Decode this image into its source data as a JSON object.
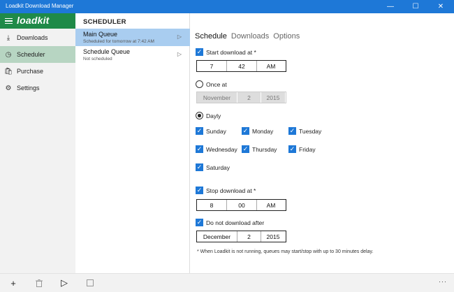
{
  "window": {
    "title": "Loadkit Download Manager",
    "controls": {
      "minimize": "—",
      "maximize": "☐",
      "close": "✕"
    }
  },
  "nav": {
    "logo": "loadkit",
    "items": [
      {
        "label": "Downloads",
        "icon": "download-icon",
        "glyph": "⤓"
      },
      {
        "label": "Scheduler",
        "icon": "clock-icon",
        "glyph": "◷"
      },
      {
        "label": "Purchase",
        "icon": "cart-icon",
        "glyph": "🛍"
      },
      {
        "label": "Settings",
        "icon": "gear-icon",
        "glyph": "⚙"
      }
    ]
  },
  "list": {
    "header": "SCHEDULER",
    "queues": [
      {
        "name": "Main Queue",
        "subtitle": "Scheduled for tomorrow at 7:42 AM"
      },
      {
        "name": "Schedule Queue",
        "subtitle": "Not scheduled"
      }
    ]
  },
  "detail": {
    "tabs": [
      "Schedule",
      "Downloads",
      "Options"
    ],
    "start": {
      "label": "Start download at *",
      "hour": "7",
      "minute": "42",
      "ampm": "AM"
    },
    "once": {
      "label": "Once at",
      "month": "November",
      "day": "2",
      "year": "2015"
    },
    "daily": {
      "label": "Dayly"
    },
    "days": [
      "Sunday",
      "Monday",
      "Tuesday",
      "Wednesday",
      "Thursday",
      "Friday",
      "Saturday"
    ],
    "stop": {
      "label": "Stop download at *",
      "hour": "8",
      "minute": "00",
      "ampm": "AM"
    },
    "dont": {
      "label": "Do not download after",
      "month": "December",
      "day": "2",
      "year": "2015"
    },
    "note": "* When Loadkit is not running, queues may start/stop with up to 30 minutes delay."
  },
  "bottombar": {
    "add": "+",
    "play": "▷",
    "more": "···"
  },
  "colors": {
    "titlebar": "#1e78d7",
    "brand": "#1f8a48",
    "accent": "#1e78d7",
    "selectedQueue": "#a9cdf0",
    "selectedNav": "#b7d5c2"
  }
}
